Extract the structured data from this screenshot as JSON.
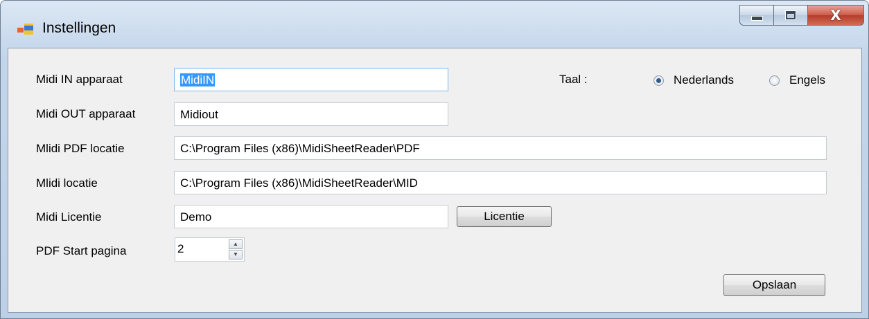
{
  "window": {
    "title": "Instellingen",
    "icons": {
      "app": "app-window-icon",
      "minimize": "minimize-icon",
      "maximize": "maximize-icon",
      "close": "close-icon"
    },
    "close_glyph": "X"
  },
  "form": {
    "midi_in": {
      "label": "Midi IN apparaat",
      "value": "MidiIN"
    },
    "midi_out": {
      "label": "Midi OUT apparaat",
      "value": "Midiout"
    },
    "pdf_loc": {
      "label": "Mlidi PDF locatie",
      "value": "C:\\Program Files (x86)\\MidiSheetReader\\PDF"
    },
    "midi_loc": {
      "label": "Mlidi locatie",
      "value": "C:\\Program Files (x86)\\MidiSheetReader\\MID"
    },
    "licentie": {
      "label": "Midi Licentie",
      "value": "Demo",
      "button": "Licentie"
    },
    "start_page": {
      "label": "PDF Start pagina",
      "value": "2",
      "up_glyph": "▲",
      "down_glyph": "▼"
    }
  },
  "language": {
    "label": "Taal :",
    "options": [
      {
        "label": "Nederlands",
        "selected": true
      },
      {
        "label": "Engels",
        "selected": false
      }
    ]
  },
  "save_button": "Opslaan",
  "colors": {
    "selection": "#3399ff",
    "client_bg": "#f0f0f0",
    "close_red": "#c74a38"
  }
}
